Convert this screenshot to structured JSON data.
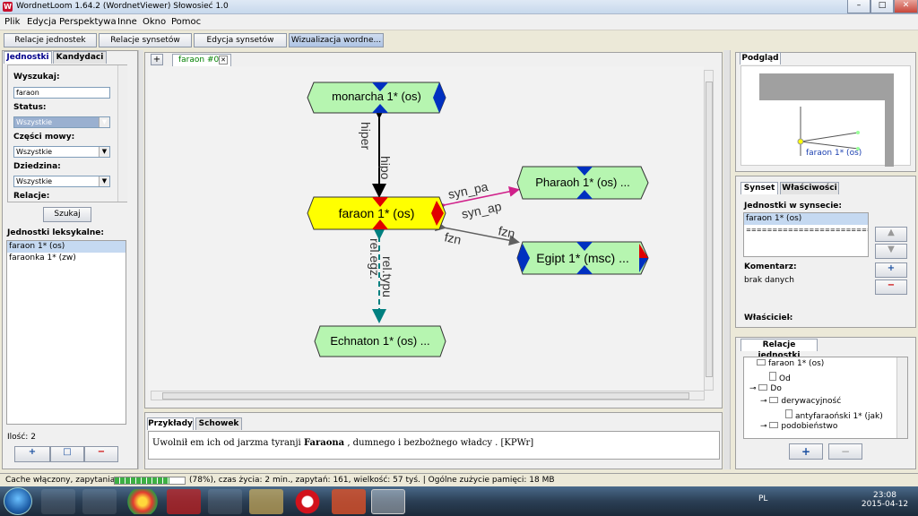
{
  "window": {
    "title": "WordnetLoom 1.64.2 (WordnetViewer) Słowosieć 1.0",
    "min": "–",
    "max": "□",
    "close": "✕"
  },
  "menu": [
    "Plik",
    "Edycja",
    "Perspektywa",
    "Inne",
    "Okno",
    "Pomoc"
  ],
  "toolbar": [
    "Relacje jednostek",
    "Relacje synsetów",
    "Edycja synsetów",
    "Wizualizacja wordne..."
  ],
  "left": {
    "tabs": [
      "Jednostki",
      "Kandydaci"
    ],
    "search_label": "Wyszukaj:",
    "search_value": "faraon",
    "status_label": "Status:",
    "status_value": "Wszystkie",
    "pos_label": "Części mowy:",
    "pos_value": "Wszystkie",
    "domain_label": "Dziedzina:",
    "domain_value": "Wszystkie",
    "relations_label": "Relacje:",
    "search_button": "Szukaj",
    "units_label": "Jednostki leksykalne:",
    "units": [
      "faraon 1* (os)",
      "faraonka 1* (zw)"
    ],
    "count": "Ilość: 2",
    "btn_add": "+",
    "btn_edit": "□",
    "btn_remove": "−"
  },
  "center": {
    "tab_label": "faraon #0",
    "plus": "+",
    "close": "✕",
    "graph": {
      "nodes": {
        "monarcha": "monarcha 1* (os)",
        "faraon": "faraon 1* (os)",
        "pharaoh": "Pharaoh 1* (os) ...",
        "egipt": "Egipt 1* (msc) ...",
        "echnaton": "Echnaton 1* (os) ..."
      },
      "edges": {
        "hiper": "hiper",
        "hipo": "hipo",
        "syn_pa": "syn_pa",
        "syn_ap": "syn_ap",
        "fzn1": "fzn",
        "fzn2": "fzn",
        "rel_egz": "rel.egz.",
        "rel_typu": "rel.typu"
      }
    },
    "bottom_tabs": [
      "Przykłady",
      "Schowek"
    ],
    "example_pre": "Uwolnił em ich od jarzma tyranji ",
    "example_bold": "Faraona",
    "example_post": " , dumnego i bezbożnego władcy . [KPWr]"
  },
  "right": {
    "preview_tab": "Podgląd",
    "preview_label": "faraon 1* (os)",
    "tabs": [
      "Synset",
      "Właściwości"
    ],
    "units_label": "Jednostki w synsecie:",
    "units": [
      "faraon 1* (os)",
      "=========================================="
    ],
    "comment_label": "Komentarz:",
    "comment_value": "brak danych",
    "owner_label": "Właściciel:",
    "owner_value": "-",
    "relations_tab": "Relacje jednostki",
    "tree": [
      "faraon 1* (os)",
      "Od",
      "Do",
      "derywacyjność",
      "antyfaraoński 1* (jak)",
      "podobieństwo"
    ],
    "btn_add": "+",
    "btn_remove": "−"
  },
  "status": {
    "pre": "Cache włączony, zapytania:",
    "post": "(78%), czas życia: 2 min., zapytań: 161, wielkość: 57 tyś. | Ogólne zużycie pamięci: 18 MB",
    "progress": 0.78
  },
  "taskbar": {
    "lang": "PL",
    "time": "23:08",
    "date": "2015-04-12"
  },
  "colors": {
    "faraon_node": "#ffff00",
    "other_node": "#b6f5b0",
    "pointer_red": "#e00000",
    "pointer_blue": "#0030c0",
    "syn_edge": "#d0208a",
    "rel_edge": "#008080"
  }
}
